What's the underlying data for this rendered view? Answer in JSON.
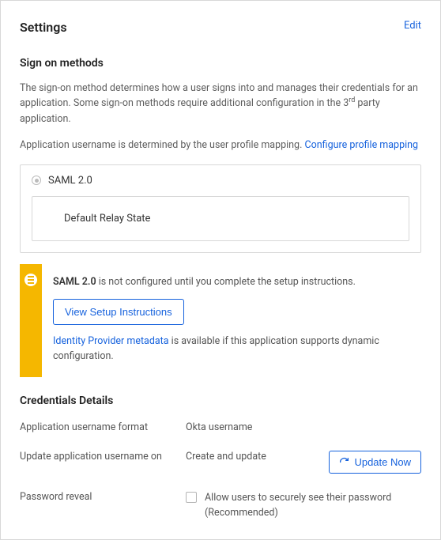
{
  "header": {
    "title": "Settings",
    "edit": "Edit"
  },
  "signOn": {
    "title": "Sign on methods",
    "desc_part1": "The sign-on method determines how a user signs into and manages their credentials for an application. Some sign-on methods require additional configuration in the 3",
    "desc_sup": "rd",
    "desc_part2": " party application.",
    "username_desc": "Application username is determined by the user profile mapping. ",
    "configure_link": "Configure profile mapping",
    "method_label": "SAML 2.0",
    "relay_label": "Default Relay State"
  },
  "notice": {
    "strong": "SAML 2.0",
    "line1_rest": " is not configured until you complete the setup instructions.",
    "button": "View Setup Instructions",
    "link": "Identity Provider metadata",
    "line2_rest": " is available if this application supports dynamic configuration."
  },
  "credentials": {
    "title": "Credentials Details",
    "rows": {
      "username_format": {
        "label": "Application username format",
        "value": "Okta username"
      },
      "update_on": {
        "label": "Update application username on",
        "value": "Create and update",
        "button": "Update Now"
      },
      "password_reveal": {
        "label": "Password reveal",
        "checkbox_text": "Allow users to securely see their password (Recommended)"
      }
    }
  }
}
